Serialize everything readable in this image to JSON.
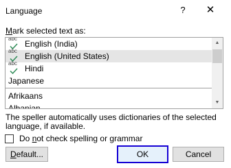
{
  "dialog": {
    "title": "Language",
    "help_glyph": "?",
    "close_glyph": "✕"
  },
  "list": {
    "label_mnemonic": "M",
    "label_rest": "ark selected text as:",
    "items_with_icon": [
      {
        "abc": "abc",
        "label": "English (India)",
        "selected": false
      },
      {
        "abc": "abc",
        "label": "English (United States)",
        "selected": true
      },
      {
        "abc": "abc",
        "label": "Hindi",
        "selected": false
      }
    ],
    "items_plain_top": [
      "Japanese"
    ],
    "items_plain_bottom": [
      "Afrikaans",
      "Albanian"
    ],
    "scroll_up_glyph": "▲",
    "scroll_down_glyph": "▼"
  },
  "info": {
    "text": "The speller automatically uses dictionaries of the selected language, if available."
  },
  "checkbox": {
    "label_prefix": "Do ",
    "label_mnemonic": "n",
    "label_suffix": "ot check spelling or grammar",
    "checked": false
  },
  "buttons": {
    "default_prefix": "",
    "default_mnemonic": "D",
    "default_suffix": "efault...",
    "ok": "OK",
    "cancel": "Cancel"
  },
  "colors": {
    "selected_row": "#e5e5e5",
    "ok_focus_border": "#1400d4",
    "check_mark": "#2e8b57"
  }
}
